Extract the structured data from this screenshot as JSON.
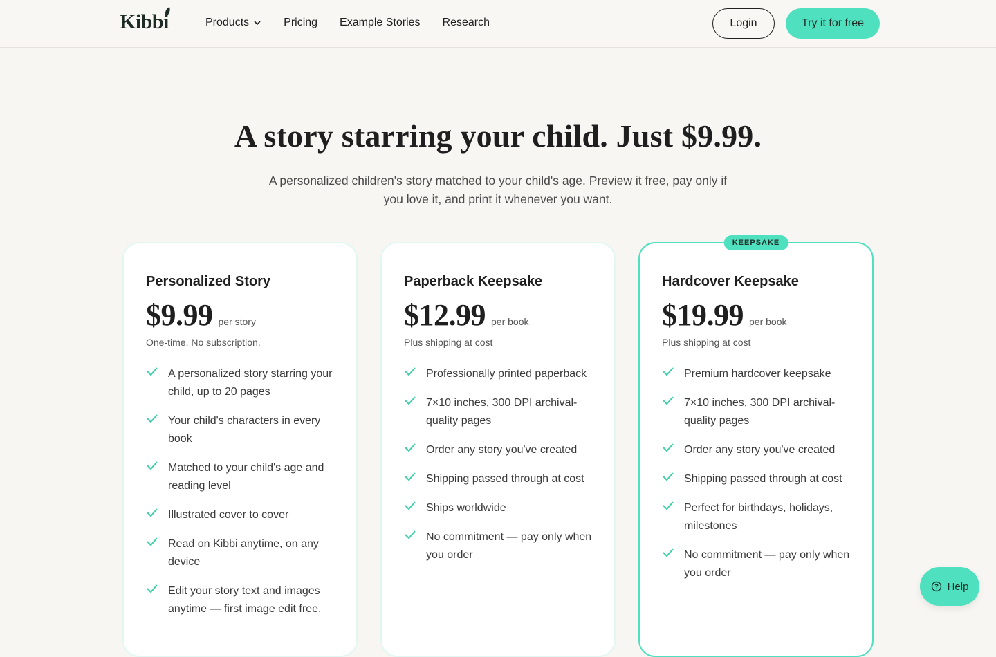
{
  "nav": {
    "logo": "Kibbi",
    "links": [
      "Products",
      "Pricing",
      "Example Stories",
      "Research"
    ],
    "login": "Login",
    "cta": "Try it for free"
  },
  "hero": {
    "title": "A story starring your child. Just $9.99.",
    "subtitle": "A personalized children's story matched to your child's age. Preview it free, pay only if you love it, and print it whenever you want."
  },
  "plans": [
    {
      "title": "Personalized Story",
      "price": "$9.99",
      "per": "per story",
      "note": "One-time. No subscription.",
      "features": [
        "A personalized story starring your child, up to 20 pages",
        "Your child's characters in every book",
        "Matched to your child's age and reading level",
        "Illustrated cover to cover",
        "Read on Kibbi anytime, on any device",
        "Edit your story text and images anytime — first image edit free,"
      ]
    },
    {
      "title": "Paperback Keepsake",
      "price": "$12.99",
      "per": "per book",
      "note": "Plus shipping at cost",
      "features": [
        "Professionally printed paperback",
        "7×10 inches, 300 DPI archival-quality pages",
        "Order any story you've created",
        "Shipping passed through at cost",
        "Ships worldwide",
        "No commitment — pay only when you order"
      ]
    },
    {
      "title": "Hardcover Keepsake",
      "badge": "KEEPSAKE",
      "price": "$19.99",
      "per": "per book",
      "note": "Plus shipping at cost",
      "features": [
        "Premium hardcover keepsake",
        "7×10 inches, 300 DPI archival-quality pages",
        "Order any story you've created",
        "Shipping passed through at cost",
        "Perfect for birthdays, holidays, milestones",
        "No commitment — pay only when you order"
      ]
    }
  ],
  "help": "Help",
  "colors": {
    "accent": "#4fe0bf",
    "background": "#f8f6f2",
    "check": "#3fcfa9"
  }
}
